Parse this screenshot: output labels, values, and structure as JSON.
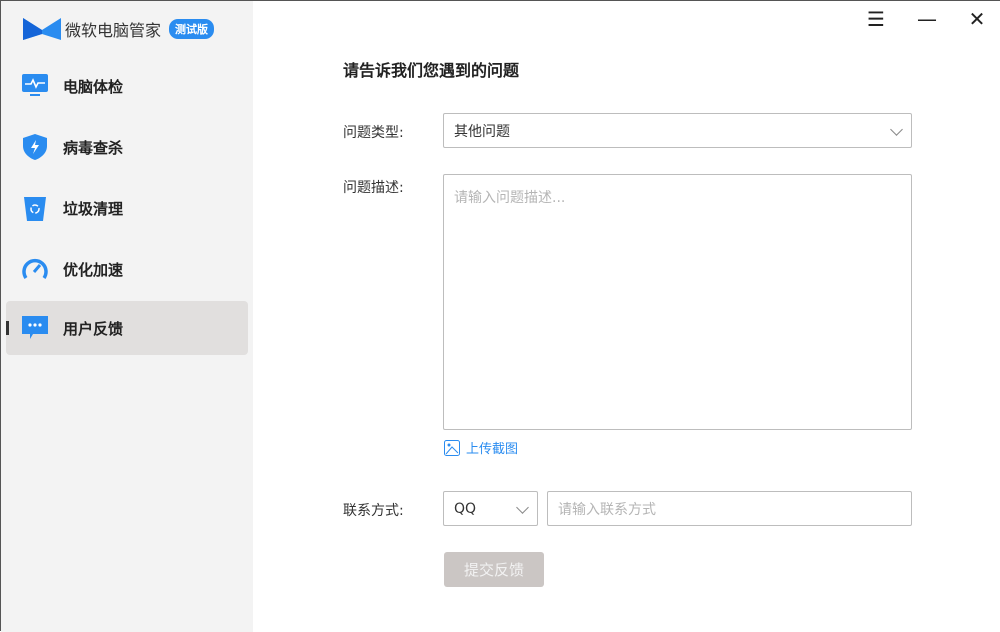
{
  "app": {
    "name": "微软电脑管家",
    "badge": "测试版"
  },
  "window": {
    "menu_icon": "hamburger-icon",
    "minimize_icon": "minimize-icon",
    "close_icon": "close-icon"
  },
  "sidebar": {
    "items": [
      {
        "label": "电脑体检",
        "icon": "monitor-pulse-icon"
      },
      {
        "label": "病毒查杀",
        "icon": "shield-bolt-icon"
      },
      {
        "label": "垃圾清理",
        "icon": "recycle-bin-icon"
      },
      {
        "label": "优化加速",
        "icon": "speedometer-icon"
      },
      {
        "label": "用户反馈",
        "icon": "chat-bubble-icon",
        "active": true
      }
    ]
  },
  "form": {
    "title": "请告诉我们您遇到的问题",
    "type_label": "问题类型:",
    "type_value": "其他问题",
    "desc_label": "问题描述:",
    "desc_placeholder": "请输入问题描述...",
    "upload_label": "上传截图",
    "contact_label": "联系方式:",
    "contact_type": "QQ",
    "contact_placeholder": "请输入联系方式",
    "submit_label": "提交反馈"
  },
  "colors": {
    "accent": "#2a8cf0",
    "sidebar_bg": "#f3f3f3",
    "active_bg": "#e1dfde",
    "submit_disabled": "#cbc6c4"
  }
}
